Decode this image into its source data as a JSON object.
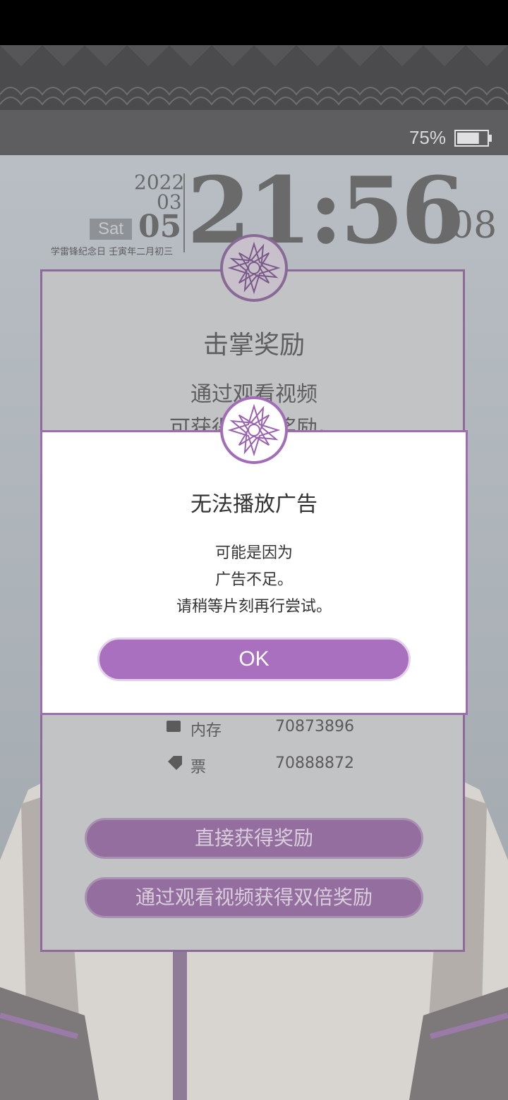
{
  "status_bar": {
    "battery_percent": "75%",
    "battery_level": 0.75
  },
  "clock": {
    "year": "2022",
    "month": "03",
    "day": "05",
    "weekday": "Sat",
    "lunar": "学雷锋纪念日 壬寅年二月初三",
    "time": "21:56",
    "seconds": "08"
  },
  "reward_dialog": {
    "title": "击掌奖励",
    "desc_line1": "通过观看视频",
    "desc_line2": "可获得双倍奖励。",
    "owned_rows": [
      {
        "label": "内存",
        "value": "70873896"
      },
      {
        "label": "票",
        "value": "70888872"
      }
    ],
    "claim_button": "直接获得奖励",
    "double_button": "通过观看视频获得双倍奖励"
  },
  "alert": {
    "title": "无法播放广告",
    "line1": "可能是因为",
    "line2": "广告不足。",
    "line3": "请稍等片刻再行尝试。",
    "ok_label": "OK"
  },
  "colors": {
    "accent": "#a970c0",
    "panel_border": "#9f6cb2"
  }
}
